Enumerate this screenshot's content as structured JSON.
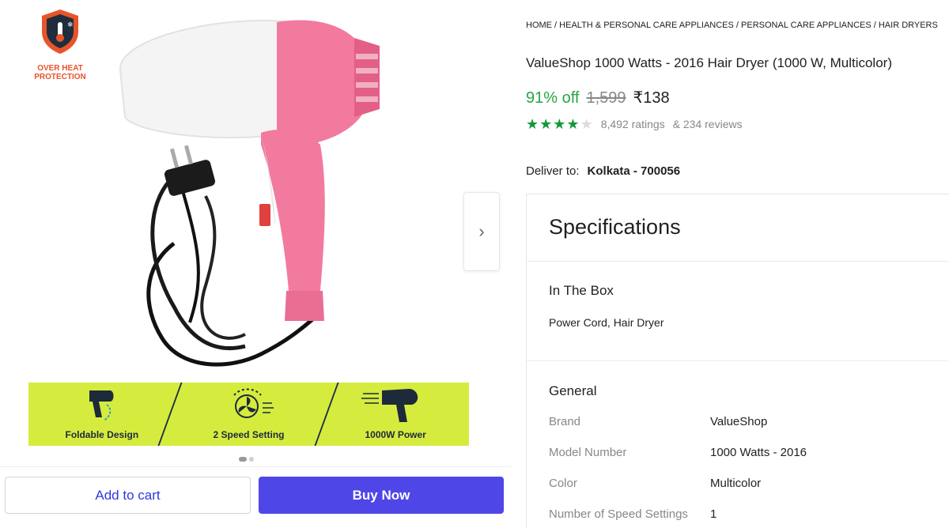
{
  "product": {
    "badge_text": "OVER HEAT PROTECTION",
    "features": [
      {
        "label": "Foldable Design",
        "icon": "foldable-dryer-icon"
      },
      {
        "label": "2 Speed Setting",
        "icon": "fan-speed-icon"
      },
      {
        "label": "1000W Power",
        "icon": "hair-dryer-power-icon"
      }
    ],
    "next_arrow": "›",
    "carousel": {
      "total": 2,
      "active": 1
    }
  },
  "actions": {
    "add_to_cart": "Add to cart",
    "buy_now": "Buy Now"
  },
  "breadcrumb": {
    "items": [
      "HOME",
      "HEALTH & PERSONAL CARE APPLIANCES",
      "PERSONAL CARE APPLIANCES",
      "HAIR DRYERS"
    ],
    "separator": " / "
  },
  "title": "ValueShop 1000 Watts - 2016 Hair Dryer (1000 W, Multicolor)",
  "price": {
    "discount": "91% off",
    "mrp": "1,599",
    "selling": "₹138"
  },
  "rating": {
    "stars": 4,
    "max": 5,
    "ratings_text": "8,492 ratings",
    "reviews_text": "& 234 reviews"
  },
  "delivery": {
    "label": "Deliver to:",
    "value": "Kolkata - 700056"
  },
  "specifications": {
    "title": "Specifications",
    "in_the_box": {
      "heading": "In The Box",
      "value": "Power Cord, Hair Dryer"
    },
    "general": {
      "heading": "General",
      "rows": [
        {
          "key": "Brand",
          "value": "ValueShop"
        },
        {
          "key": "Model Number",
          "value": "1000 Watts - 2016"
        },
        {
          "key": "Color",
          "value": "Multicolor"
        },
        {
          "key": "Number of Speed Settings",
          "value": "1"
        }
      ]
    }
  },
  "colors": {
    "buy_now": "#4f46e8",
    "add_to_cart_text": "#2d38e0",
    "discount": "#26a541",
    "star": "#14973a",
    "feature_strip": "#d5ec3e",
    "dryer_pink": "#f27a9e",
    "badge_orange": "#e8542a"
  }
}
